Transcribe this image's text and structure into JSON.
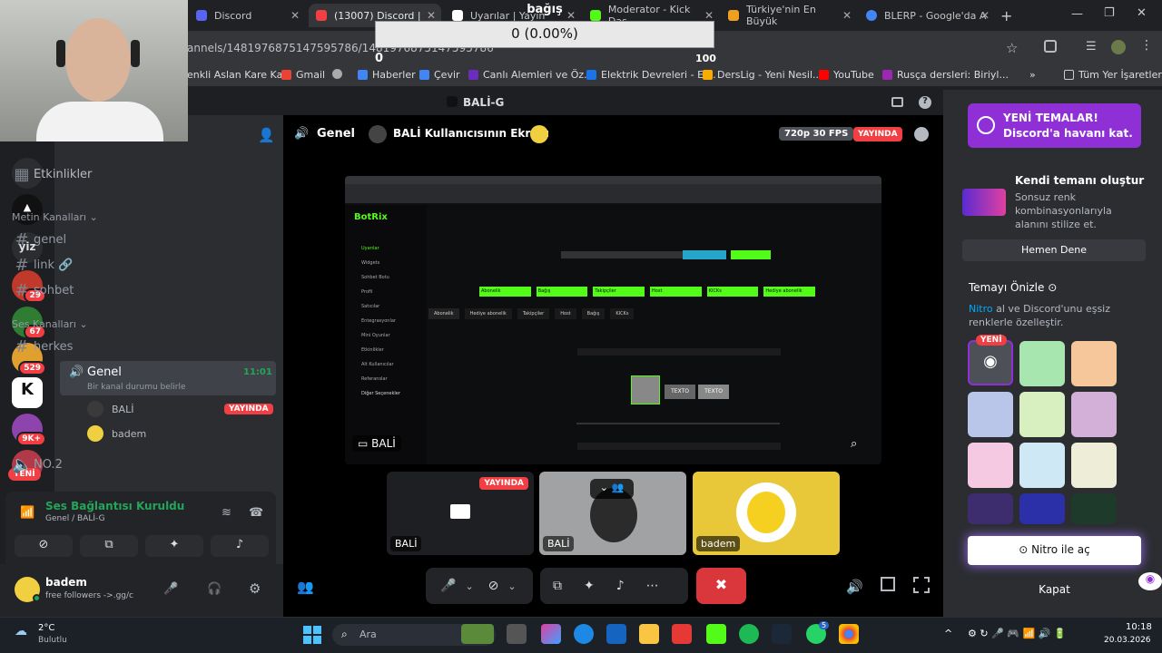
{
  "browser": {
    "tabs": [
      {
        "label": "Discord",
        "active": false
      },
      {
        "label": "(13007) Discord |",
        "active": true
      },
      {
        "label": "Uyarılar | Yayın",
        "active": false
      },
      {
        "label": "Moderator - Kick Das",
        "active": false
      },
      {
        "label": "Türkiye'nin En Büyük",
        "active": false
      },
      {
        "label": "BLERP - Google'da A",
        "active": false
      }
    ],
    "url": "annels/1481976875147595786/1481976875147595786",
    "bookmarks": [
      "enkli Aslan Kare Ka...",
      "Gmail",
      "Haberler",
      "Çevir",
      "Canlı Alemleri ve Öz...",
      "Elektrik Devreleri - El...",
      "DersLig - Yeni Nesil...",
      "YouTube",
      "Rusça dersleri: Biriyl..."
    ],
    "bookmarks_folder": "Tüm Yer İşaretleri"
  },
  "overlay": {
    "donate_label": "bağış",
    "progress_text": "0 (0.00%)",
    "progress_min": "0",
    "progress_max": "100",
    "progress_fraction": 0.0
  },
  "discord": {
    "window_title": "BALİ-G",
    "guild_badges": [
      "29",
      "67",
      "529",
      "9K+"
    ],
    "new_badge": "YENİ",
    "channels": {
      "events": "Etkinlikler",
      "text_category": "Metin Kanalları",
      "text_channels": [
        "genel",
        "link",
        "sohbet"
      ],
      "voice_category": "Ses Kanalları",
      "voice_channels": [
        "herkes"
      ],
      "active_voice": "Genel",
      "active_time": "11:01",
      "status_hint": "Bir kanal durumu belirle",
      "members": [
        {
          "name": "BALİ",
          "badge": "YAYINDA"
        },
        {
          "name": "badem",
          "badge": ""
        }
      ],
      "other_voice": "NO.2"
    },
    "voice_panel": {
      "status": "Ses Bağlantısı Kuruldu",
      "channel": "Genel / BALİ-G"
    },
    "user": {
      "name": "badem",
      "status": "free followers ->.gg/c"
    },
    "stream": {
      "channel": "Genel",
      "title": "BALİ Kullanıcısının Ekranı",
      "quality": "720p 30 FPS",
      "live": "YAYINDA",
      "screen_name": "BALİ"
    },
    "tiles": [
      {
        "name": "BALİ",
        "badge": "YAYINDA"
      },
      {
        "name": "BALİ",
        "badge": ""
      },
      {
        "name": "badem",
        "badge": ""
      }
    ]
  },
  "stream_content": {
    "logo": "BotRix",
    "menu": [
      "Uyarılar",
      "Widgets",
      "Sohbet Botu",
      "Profil",
      "Satıcılar",
      "Entegrasyonlar",
      "Mini Oyunlar",
      "Etkinlikler",
      "Alt Kullanıcılar",
      "Referanslar"
    ],
    "menu_section": "Diğer Seçenekler",
    "buttons": [
      "Abonelik",
      "Bağış",
      "Takipçiler",
      "Host",
      "KICKs",
      "Hediye abonelik"
    ],
    "subtabs": [
      "Abonelik",
      "Hediye abonelik",
      "Takipçiler",
      "Host",
      "Bağış",
      "KICKs"
    ],
    "preview_text": "TEXTO"
  },
  "sidepanel": {
    "promo_title": "YENİ TEMALAR!",
    "promo_sub": "Discord'a havanı kat.",
    "create_title": "Kendi temanı oluştur",
    "create_desc": "Sonsuz renk kombinasyonlarıyla alanını stilize et.",
    "try_btn": "Hemen Dene",
    "preview_title": "Temayı Önizle",
    "preview_desc_link": "Nitro",
    "preview_desc": " al ve Discord'unu eşsiz renklerle özelleştir.",
    "new_badge": "YENİ",
    "nitro_btn": "Nitro ile aç",
    "close": "Kapat",
    "swatch_colors": [
      "#a8e6b0",
      "#f5c79a",
      "#b9c6ea",
      "#d8f0c0",
      "#d2b0d8",
      "#f5c9e2",
      "#cfe8f5",
      "#eeeed8",
      "#3d2d6e",
      "#2b2fa8",
      "#1d3a2a"
    ]
  },
  "taskbar": {
    "weather_temp": "2°C",
    "weather_desc": "Bulutlu",
    "search": "Ara",
    "time": "10:18",
    "date": "20.03.2026",
    "whatsapp_badge": "5"
  }
}
